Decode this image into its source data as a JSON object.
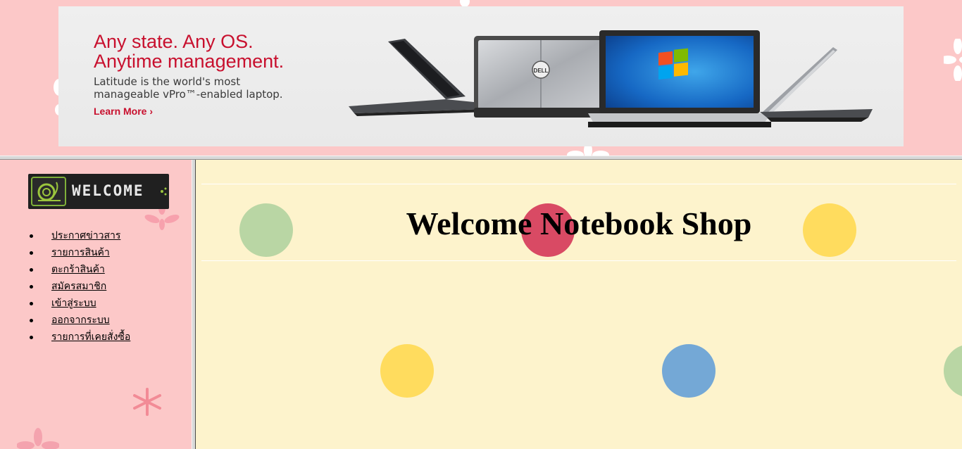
{
  "banner": {
    "headline_line1": "Any state. Any OS.",
    "headline_line2": "Anytime management.",
    "subline_line1": "Latitude is the world's most",
    "subline_line2": "manageable vPro™-enabled laptop.",
    "learn_more": "Learn More ›",
    "laptop_brand": "DELL"
  },
  "sidebar": {
    "logo_text": "WELCOME",
    "menu": [
      {
        "label": "ประกาศข่าวสาร"
      },
      {
        "label": "รายการสินค้า"
      },
      {
        "label": "ตะกร้าสินค้า"
      },
      {
        "label": "สมัครสมาชิก"
      },
      {
        "label": "เข้าสู่ระบบ"
      },
      {
        "label": "ออกจากระบบ"
      },
      {
        "label": "รายการที่เคยสั่งซื้อ"
      }
    ]
  },
  "main": {
    "title": "Welcome Notebook Shop"
  },
  "colors": {
    "top_background": "#fcc8c8",
    "sidebar_background": "#fcc8c8",
    "main_background": "#fdf3cc",
    "brand_red": "#c8102e",
    "dot_green": "#b9d6a4",
    "dot_red": "#d94a64",
    "dot_yellow": "#ffdc5e",
    "dot_blue": "#74a8d6"
  }
}
